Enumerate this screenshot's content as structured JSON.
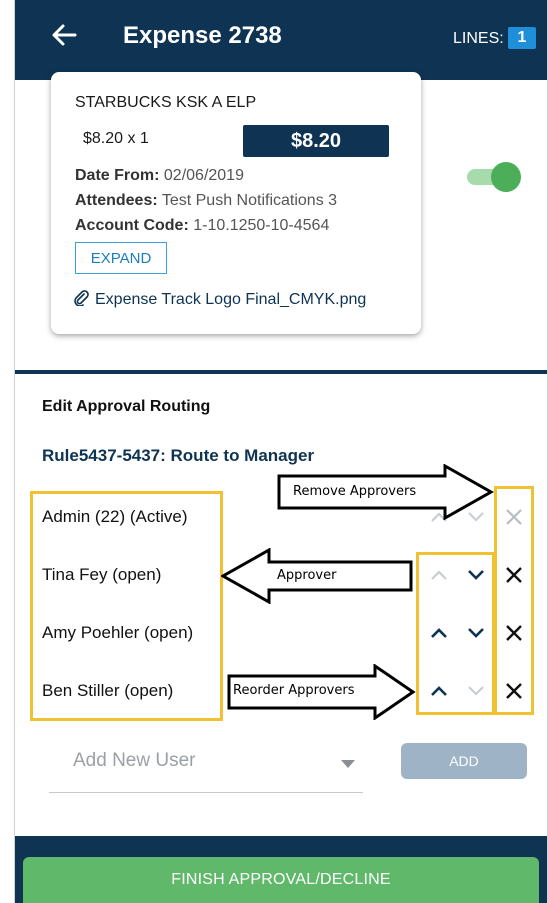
{
  "header": {
    "title": "Expense 2738",
    "lines_label": "LINES:",
    "lines_count": "1"
  },
  "card": {
    "merchant": "STARBUCKS KSK A ELP",
    "qty": "$8.20 x 1",
    "amount": "$8.20",
    "date_label": "Date From:",
    "date_value": " 02/06/2019",
    "attendees_label": "Attendees:",
    "attendees_value": " Test Push Notifications 3",
    "account_label": "Account Code:",
    "account_value": " 1-10.1250-10-4564",
    "expand_label": "EXPAND",
    "attachment": "Expense Track Logo Final_CMYK.png"
  },
  "routing": {
    "title": "Edit Approval Routing",
    "rule": "Rule5437-5437: Route to Manager",
    "approvers": [
      {
        "name": "Admin (22) (Active)"
      },
      {
        "name": "Tina Fey (open)"
      },
      {
        "name": "Amy Poehler (open)"
      },
      {
        "name": "Ben Stiller (open)"
      }
    ],
    "add_user_placeholder": "Add New User",
    "add_button": "ADD"
  },
  "annotations": {
    "remove": "Remove Approvers",
    "approver": "Approver",
    "reorder": "Reorder Approvers"
  },
  "footer": {
    "finish_button": "FINISH APPROVAL/DECLINE"
  },
  "colors": {
    "navy": "#0e3353",
    "green": "#60b86a",
    "highlight": "#f0c132",
    "link_blue": "#1e7fb8"
  }
}
